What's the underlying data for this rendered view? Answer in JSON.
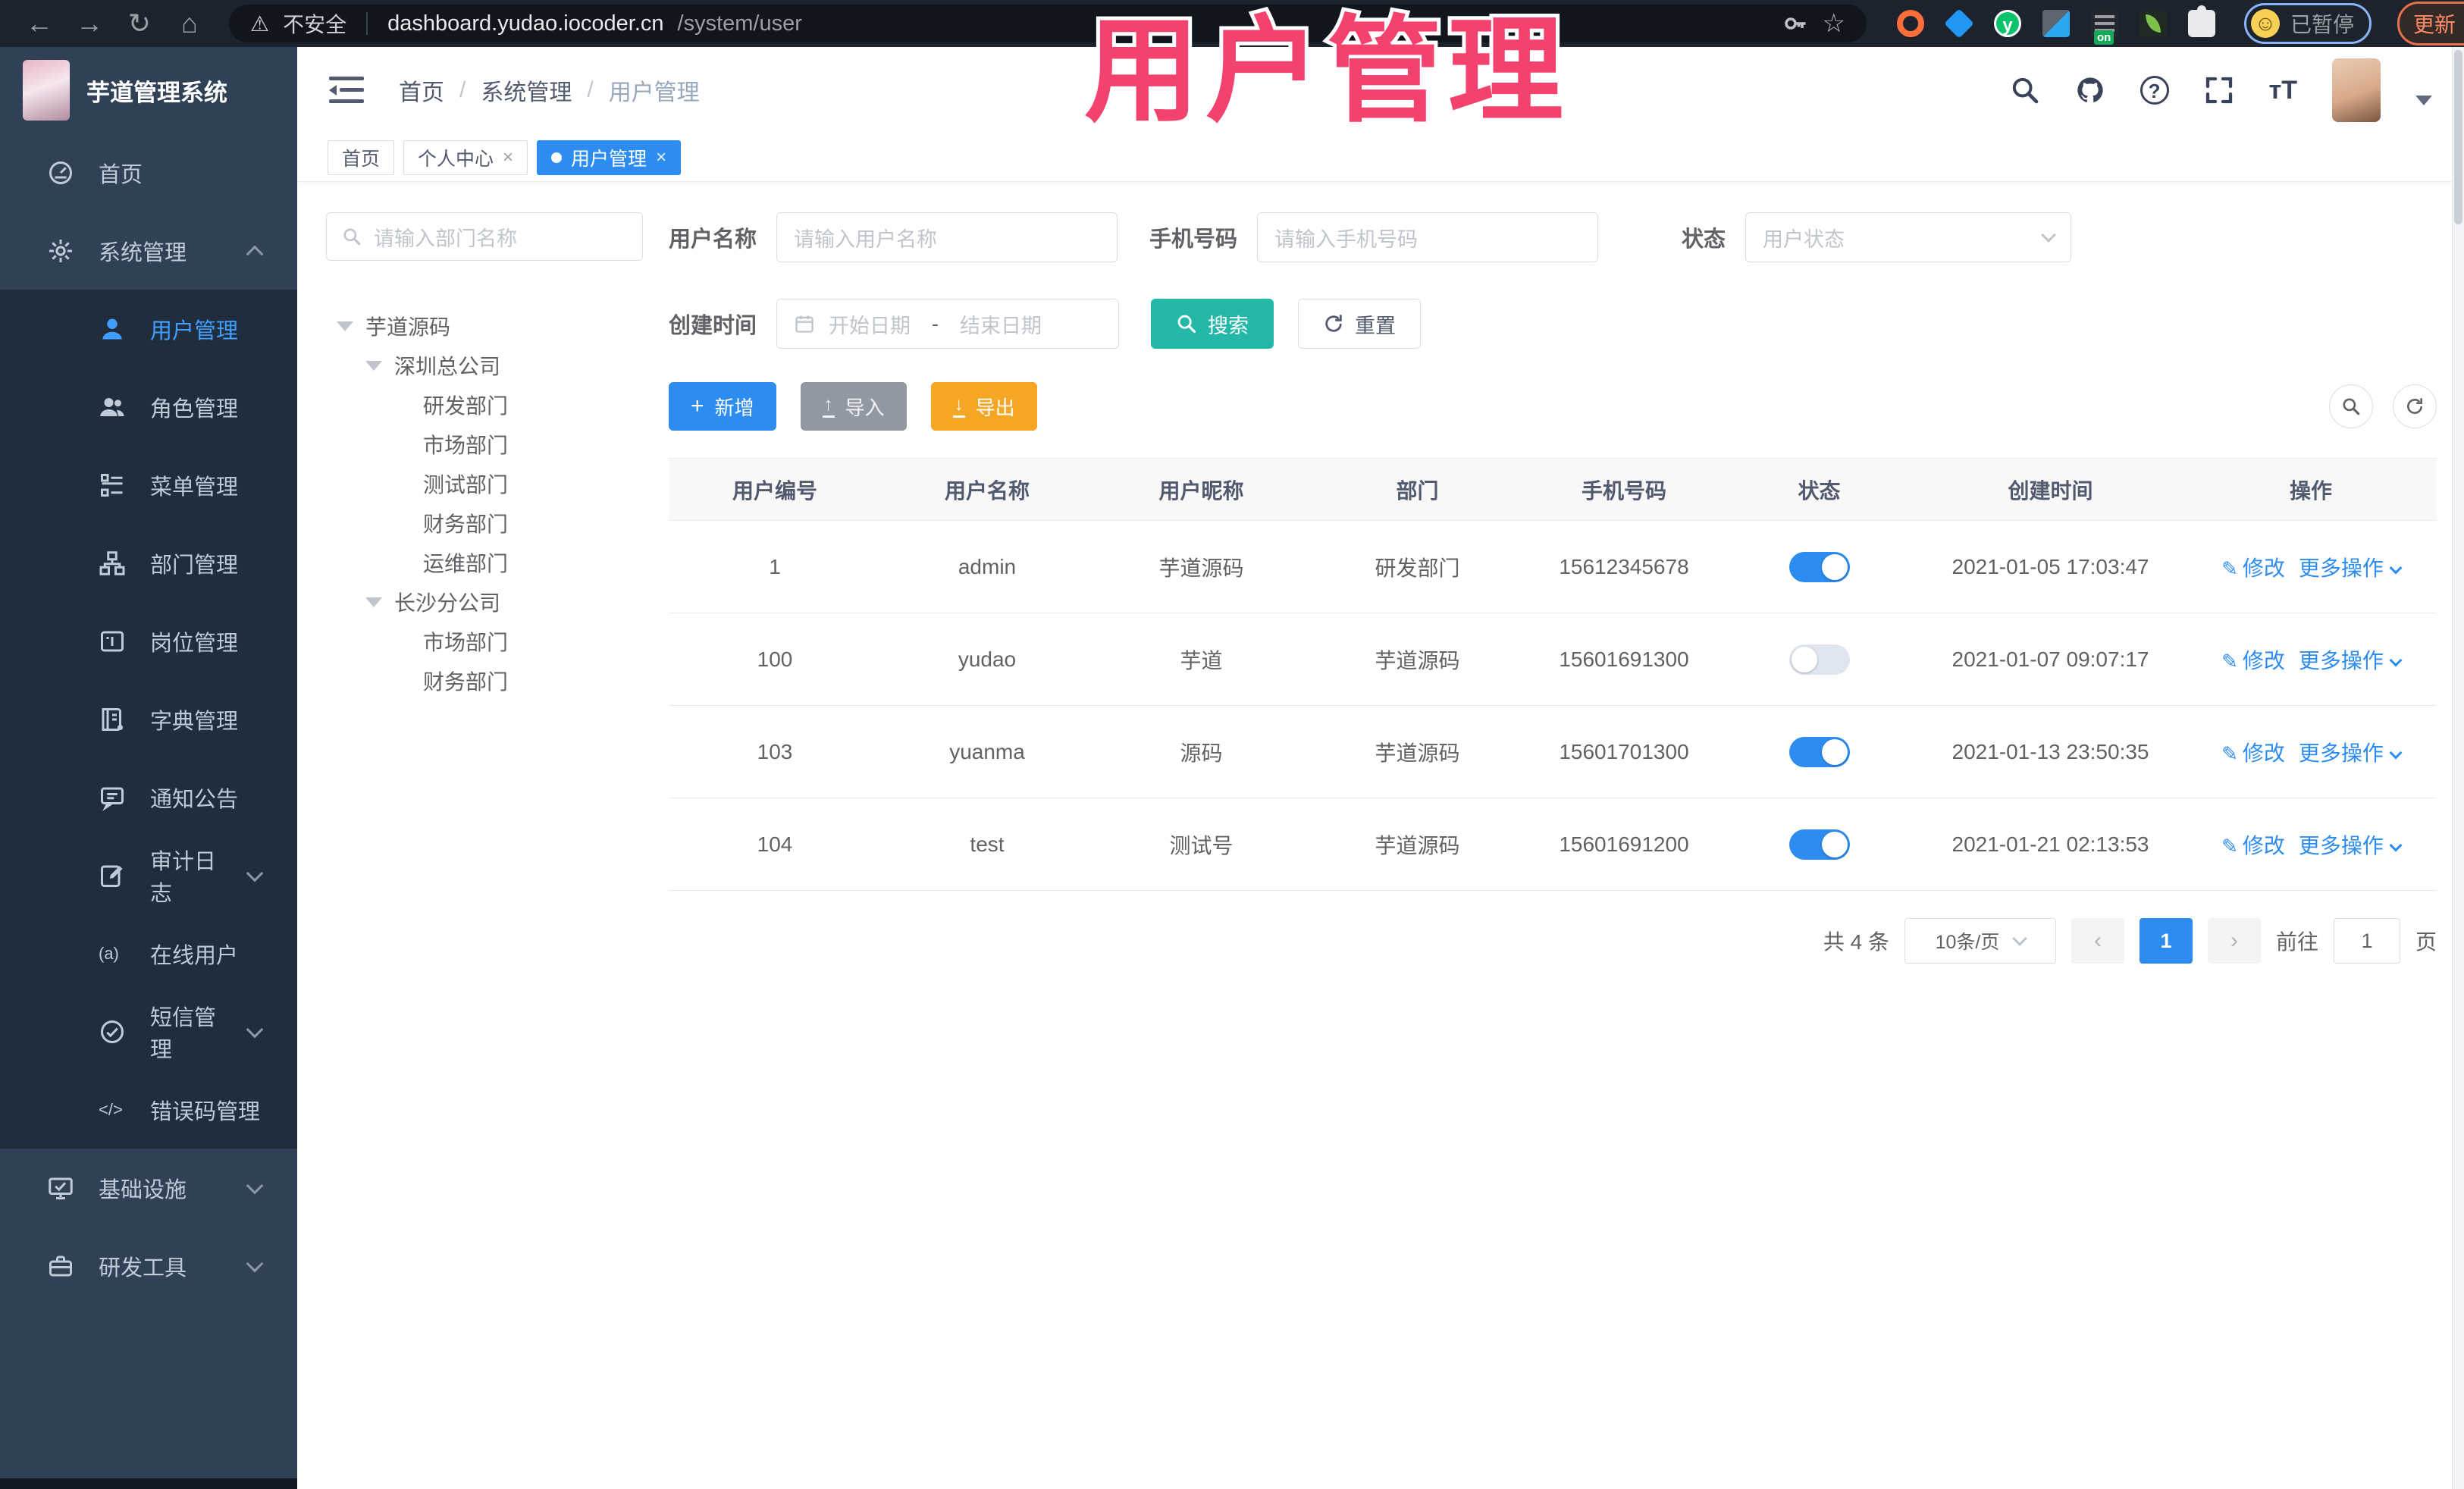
{
  "browser": {
    "security_label": "不安全",
    "url_host": "dashboard.yudao.iocoder.cn",
    "url_path": "/system/user",
    "profile_status": "已暂停",
    "update_label": "更新",
    "ext_badge": "on"
  },
  "overlay": {
    "title": "用户管理",
    "color": "#f4426f"
  },
  "sidebar": {
    "app_title": "芋道管理系统",
    "menu": [
      {
        "label": "首页"
      },
      {
        "label": "系统管理"
      },
      {
        "label": "用户管理"
      },
      {
        "label": "角色管理"
      },
      {
        "label": "菜单管理"
      },
      {
        "label": "部门管理"
      },
      {
        "label": "岗位管理"
      },
      {
        "label": "字典管理"
      },
      {
        "label": "通知公告"
      },
      {
        "label": "审计日志"
      },
      {
        "label": "在线用户"
      },
      {
        "label": "短信管理"
      },
      {
        "label": "错误码管理"
      },
      {
        "label": "基础设施"
      },
      {
        "label": "研发工具"
      }
    ],
    "online_glyph": "(a)",
    "code_glyph": "</>"
  },
  "header": {
    "breadcrumb": [
      "首页",
      "系统管理",
      "用户管理"
    ],
    "font_icon": "тT"
  },
  "tags": {
    "items": [
      {
        "label": "首页"
      },
      {
        "label": "个人中心"
      },
      {
        "label": "用户管理"
      }
    ],
    "close_glyph": "×"
  },
  "tree": {
    "search_placeholder": "请输入部门名称",
    "nodes": [
      {
        "label": "芋道源码"
      },
      {
        "label": "深圳总公司"
      },
      {
        "label": "研发部门"
      },
      {
        "label": "市场部门"
      },
      {
        "label": "测试部门"
      },
      {
        "label": "财务部门"
      },
      {
        "label": "运维部门"
      },
      {
        "label": "长沙分公司"
      },
      {
        "label": "市场部门"
      },
      {
        "label": "财务部门"
      }
    ]
  },
  "filters": {
    "username_label": "用户名称",
    "username_placeholder": "请输入用户名称",
    "mobile_label": "手机号码",
    "mobile_placeholder": "请输入手机号码",
    "status_label": "状态",
    "status_placeholder": "用户状态",
    "created_label": "创建时间",
    "date_start_placeholder": "开始日期",
    "date_separator": "-",
    "date_end_placeholder": "结束日期",
    "search_button": "搜索",
    "reset_button": "重置"
  },
  "toolbar": {
    "add_label": "新增",
    "import_label": "导入",
    "export_label": "导出"
  },
  "table": {
    "columns": [
      "用户编号",
      "用户名称",
      "用户昵称",
      "部门",
      "手机号码",
      "状态",
      "创建时间",
      "操作"
    ],
    "rows": [
      {
        "id": "1",
        "username": "admin",
        "nickname": "芋道源码",
        "dept": "研发部门",
        "mobile": "15612345678",
        "status": "on",
        "created": "2021-01-05 17:03:47",
        "modify": "修改",
        "more": "更多操作"
      },
      {
        "id": "100",
        "username": "yudao",
        "nickname": "芋道",
        "dept": "芋道源码",
        "mobile": "15601691300",
        "status": "off",
        "created": "2021-01-07 09:07:17",
        "modify": "修改",
        "more": "更多操作"
      },
      {
        "id": "103",
        "username": "yuanma",
        "nickname": "源码",
        "dept": "芋道源码",
        "mobile": "15601701300",
        "status": "on",
        "created": "2021-01-13 23:50:35",
        "modify": "修改",
        "more": "更多操作"
      },
      {
        "id": "104",
        "username": "test",
        "nickname": "测试号",
        "dept": "芋道源码",
        "mobile": "15601691200",
        "status": "on",
        "created": "2021-01-21 02:13:53",
        "modify": "修改",
        "more": "更多操作"
      }
    ]
  },
  "pagination": {
    "total": "共 4 条",
    "page_size": "10条/页",
    "prev": "‹",
    "current_page": "1",
    "next": "›",
    "goto_label": "前往",
    "goto_value": "1",
    "page_unit": "页"
  },
  "colors": {
    "accent": "#2d8cf0",
    "teal": "#23b8a8",
    "amber": "#f5a623",
    "sidebar_bg": "#304156",
    "submenu_bg": "#1f2d3d"
  }
}
